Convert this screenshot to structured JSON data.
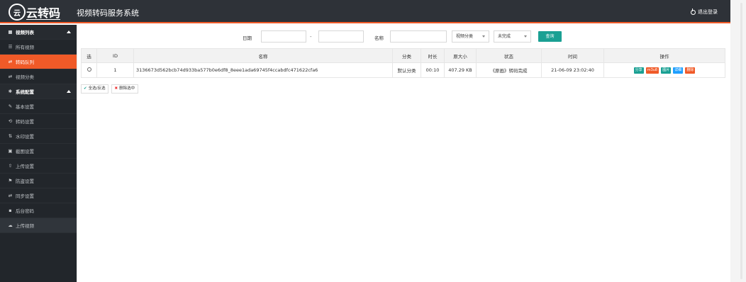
{
  "header": {
    "logo_mark": "云",
    "logo_text": "云转码",
    "app_title": "视频转码服务系统",
    "logout_label": "退出登录"
  },
  "sidebar": {
    "items": [
      {
        "label": "视频列表",
        "icon": "video-icon"
      },
      {
        "label": "所有视频",
        "icon": "list-icon"
      },
      {
        "label": "转码队列",
        "icon": "exchange-icon"
      },
      {
        "label": "视频分类",
        "icon": "exchange-icon"
      },
      {
        "label": "系统配置",
        "icon": "gear-icon"
      },
      {
        "label": "基本设置",
        "icon": "edit-icon"
      },
      {
        "label": "转码设置",
        "icon": "sync-icon"
      },
      {
        "label": "水印设置",
        "icon": "sort-icon"
      },
      {
        "label": "截图设置",
        "icon": "image-icon"
      },
      {
        "label": "上传设置",
        "icon": "upload-icon"
      },
      {
        "label": "防盗设置",
        "icon": "flag-icon"
      },
      {
        "label": "同步设置",
        "icon": "exchange-icon"
      },
      {
        "label": "后台密码",
        "icon": "lock-icon"
      },
      {
        "label": "上传视频",
        "icon": "cloud-upload-icon"
      }
    ]
  },
  "filter": {
    "date_label": "日期",
    "date_sep": "-",
    "name_label": "名称",
    "category_select": "视频分类",
    "status_select": "未完成",
    "query_button": "查询"
  },
  "table": {
    "headers": [
      "选",
      "ID",
      "名称",
      "分类",
      "时长",
      "原大小",
      "状态",
      "时间",
      "操作"
    ],
    "rows": [
      {
        "id": "1",
        "name": "3136673d562bcb74d933ba577b0e6df8_8eee1ada69745f4ccabdfc471622cfa6",
        "category": "默认分类",
        "duration": "00:10",
        "size": "407.29 KB",
        "status": "《原画》转码完成",
        "time": "21-06-09 23:02:40",
        "ops": [
          "分享",
          "m3u8",
          "图片",
          "详细",
          "删除"
        ]
      }
    ]
  },
  "bulk": {
    "select_all": "全选/反选",
    "delete_selected": "删除选中"
  },
  "colors": {
    "topbar": "#2e3238",
    "accent": "#f05a28",
    "sidebar": "#22262b",
    "primary": "#1aa093",
    "status_done": "#2e9e45"
  }
}
